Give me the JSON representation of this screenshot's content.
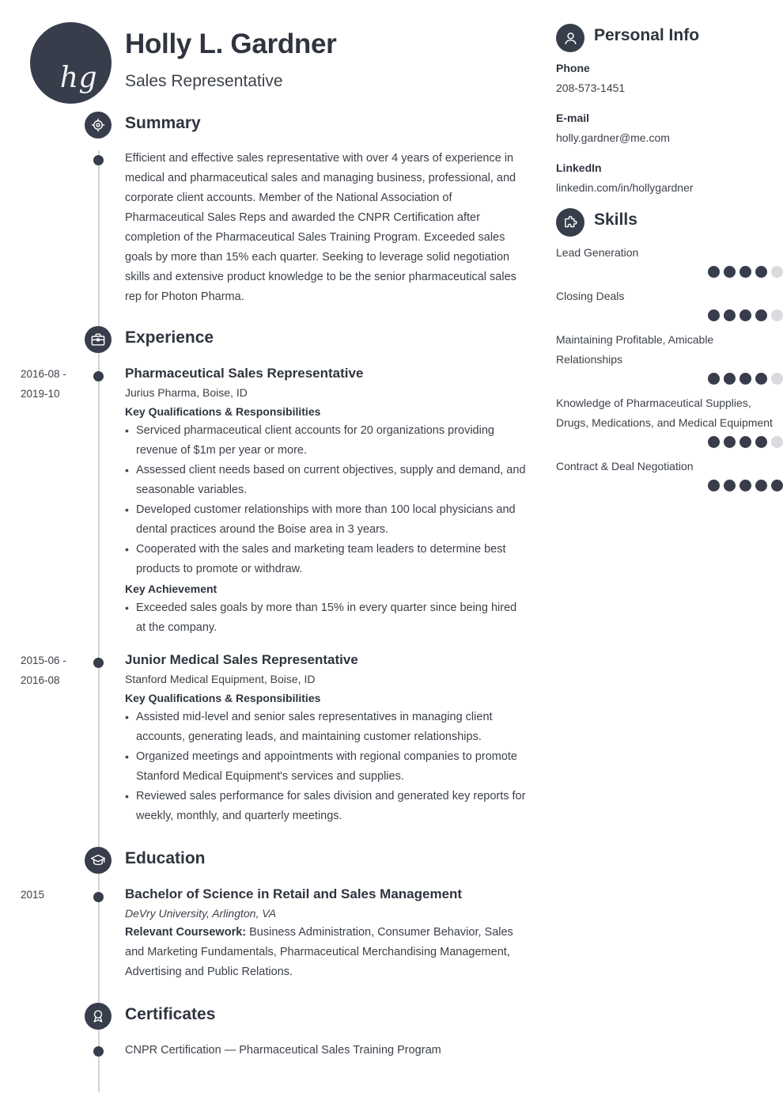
{
  "header": {
    "monogram": "hg",
    "name": "Holly L. Gardner",
    "job_title": "Sales Representative"
  },
  "theme": {
    "dark": "#373d4b",
    "rail": "#d2d4d8",
    "dot_empty": "#d9dbde",
    "text": "#3c4149"
  },
  "sections": {
    "summary": {
      "icon": "target-icon",
      "title": "Summary",
      "text": "Efficient and effective sales representative with over 4 years of experience in medical and pharmaceutical sales and managing business, professional, and corporate client accounts. Member of the National Association of Pharmaceutical Sales Reps and awarded the CNPR Certification after completion of the Pharmaceutical Sales Training Program. Exceeded sales goals by more than 15% each quarter. Seeking to leverage solid negotiation skills and extensive product knowledge to be the senior pharmaceutical sales rep for Photon Pharma."
    },
    "experience": {
      "icon": "briefcase-icon",
      "title": "Experience",
      "entries": [
        {
          "date_line1": "2016-08 -",
          "date_line2": "2019-10",
          "title": "Pharmaceutical Sales Representative",
          "company": "Jurius Pharma, Boise, ID",
          "quals_label": "Key Qualifications & Responsibilities",
          "quals": [
            "Serviced pharmaceutical client accounts for 20 organizations providing revenue of $1m per year or more.",
            "Assessed client needs based on current objectives, supply and demand, and seasonable variables.",
            "Developed customer relationships with more than 100 local physicians and dental practices around the Boise area in 3 years.",
            "Cooperated with the sales and marketing team leaders to determine best products to promote or withdraw."
          ],
          "achievement_label": "Key Achievement",
          "achievements": [
            "Exceeded sales goals by more than 15% in every quarter since being hired at the company."
          ]
        },
        {
          "date_line1": "2015-06 -",
          "date_line2": "2016-08",
          "title": "Junior Medical Sales Representative",
          "company": "Stanford Medical Equipment, Boise, ID",
          "quals_label": "Key Qualifications & Responsibilities",
          "quals": [
            "Assisted mid-level and senior sales representatives in managing client accounts, generating leads, and maintaining customer relationships.",
            "Organized meetings and appointments with regional companies to promote Stanford Medical Equipment's services and supplies.",
            "Reviewed sales performance for sales division and generated key reports for weekly, monthly, and quarterly meetings."
          ],
          "achievement_label": "",
          "achievements": []
        }
      ]
    },
    "education": {
      "icon": "graduation-cap-icon",
      "title": "Education",
      "entries": [
        {
          "date_line1": "2015",
          "date_line2": "",
          "degree": "Bachelor of Science in Retail and Sales Management",
          "school": "DeVry University, Arlington, VA",
          "coursework_label": "Relevant Coursework:",
          "coursework": " Business Administration, Consumer Behavior, Sales and Marketing Fundamentals, Pharmaceutical Merchandising Management, Advertising and Public Relations."
        }
      ]
    },
    "certificates": {
      "icon": "award-ribbon-icon",
      "title": "Certificates",
      "items": [
        "CNPR Certification — Pharmaceutical Sales Training Program"
      ]
    }
  },
  "sidebar": {
    "personal_info": {
      "icon": "user-icon",
      "title": "Personal Info",
      "fields": [
        {
          "label": "Phone",
          "value": "208-573-1451"
        },
        {
          "label": "E-mail",
          "value": "holly.gardner@me.com"
        },
        {
          "label": "LinkedIn",
          "value": "linkedin.com/in/hollygardner"
        }
      ]
    },
    "skills": {
      "icon": "puzzle-piece-icon",
      "title": "Skills",
      "max_rating": 5,
      "items": [
        {
          "name": "Lead Generation",
          "rating": 4
        },
        {
          "name": "Closing Deals",
          "rating": 4
        },
        {
          "name": "Maintaining Profitable, Amicable Relationships",
          "rating": 4
        },
        {
          "name": "Knowledge of Pharmaceutical Supplies, Drugs, Medications, and Medical Equipment",
          "rating": 4
        },
        {
          "name": "Contract & Deal Negotiation",
          "rating": 5
        }
      ]
    }
  }
}
